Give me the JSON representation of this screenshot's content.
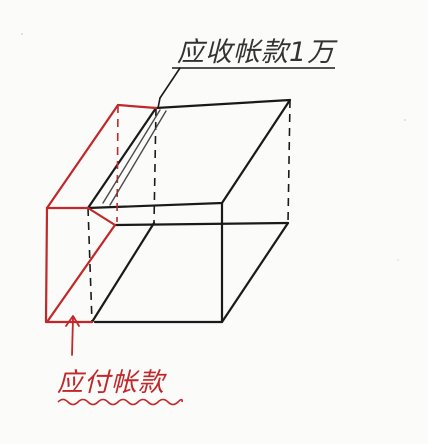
{
  "labels": {
    "receivable": "应收帐款1万",
    "payable": "应付帐款"
  },
  "colors": {
    "ink": "#1a1a1a",
    "pencil": "#4a4a4a",
    "red": "#c0282a",
    "paper": "#fbfbfa"
  }
}
